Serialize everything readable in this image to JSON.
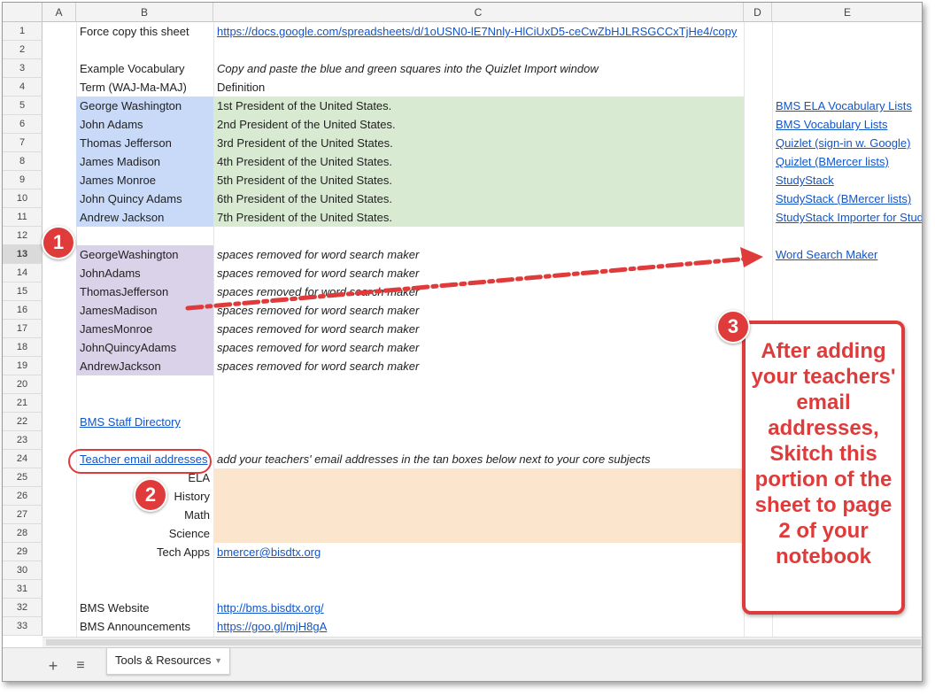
{
  "columns": [
    "A",
    "B",
    "C",
    "D",
    "E"
  ],
  "rows": [
    {
      "n": "1",
      "b": "Force copy this sheet",
      "c": "https://docs.google.com/spreadsheets/d/1oUSN0-lE7Nnly-HlCiUxD5-ceCwZbHJLRSGCCxTjHe4/copy",
      "e": ""
    },
    {
      "n": "2",
      "b": "",
      "c": "",
      "e": ""
    },
    {
      "n": "3",
      "b": "Example Vocabulary",
      "c": "Copy and paste the blue and green squares into the Quizlet Import window",
      "e": ""
    },
    {
      "n": "4",
      "b": "Term (WAJ-Ma-MAJ)",
      "c": "Definition",
      "e": ""
    },
    {
      "n": "5",
      "b": "George Washington",
      "c": "1st President of the United States.",
      "e": "BMS ELA Vocabulary Lists"
    },
    {
      "n": "6",
      "b": "John Adams",
      "c": "2nd President of the United States.",
      "e": "BMS Vocabulary Lists"
    },
    {
      "n": "7",
      "b": "Thomas Jefferson",
      "c": "3rd President of the United States.",
      "e": "Quizlet (sign-in w. Google)"
    },
    {
      "n": "8",
      "b": "James Madison",
      "c": "4th President of the United States.",
      "e": "Quizlet (BMercer lists)"
    },
    {
      "n": "9",
      "b": "James Monroe",
      "c": "5th President of the United States.",
      "e": "StudyStack"
    },
    {
      "n": "10",
      "b": "John Quincy Adams",
      "c": "6th President of the United States.",
      "e": "StudyStack (BMercer lists)"
    },
    {
      "n": "11",
      "b": "Andrew Jackson",
      "c": "7th President of the United States.",
      "e": "StudyStack Importer for Study"
    },
    {
      "n": "12",
      "b": "",
      "c": "",
      "e": ""
    },
    {
      "n": "13",
      "b": "GeorgeWashington",
      "c": "spaces removed for word search maker",
      "e": "Word Search Maker"
    },
    {
      "n": "14",
      "b": "JohnAdams",
      "c": "spaces removed for word search maker",
      "e": ""
    },
    {
      "n": "15",
      "b": "ThomasJefferson",
      "c": "spaces removed for word search maker",
      "e": ""
    },
    {
      "n": "16",
      "b": "JamesMadison",
      "c": "spaces removed for word search maker",
      "e": ""
    },
    {
      "n": "17",
      "b": "JamesMonroe",
      "c": "spaces removed for word search maker",
      "e": ""
    },
    {
      "n": "18",
      "b": "JohnQuincyAdams",
      "c": "spaces removed for word search maker",
      "e": ""
    },
    {
      "n": "19",
      "b": "AndrewJackson",
      "c": "spaces removed for word search maker",
      "e": ""
    },
    {
      "n": "20",
      "b": "",
      "c": "",
      "e": ""
    },
    {
      "n": "21",
      "b": "",
      "c": "",
      "e": ""
    },
    {
      "n": "22",
      "b": "BMS Staff Directory",
      "c": "",
      "e": ""
    },
    {
      "n": "23",
      "b": "",
      "c": "",
      "e": ""
    },
    {
      "n": "24",
      "b": "Teacher email addresses",
      "c": "add your teachers' email addresses in the tan boxes below next to your core subjects",
      "e": ""
    },
    {
      "n": "25",
      "b": "ELA",
      "c": "",
      "e": ""
    },
    {
      "n": "26",
      "b": "History",
      "c": "",
      "e": ""
    },
    {
      "n": "27",
      "b": "Math",
      "c": "",
      "e": ""
    },
    {
      "n": "28",
      "b": "Science",
      "c": "",
      "e": ""
    },
    {
      "n": "29",
      "b": "Tech Apps",
      "c": "bmercer@bisdtx.org",
      "e": ""
    },
    {
      "n": "30",
      "b": "",
      "c": "",
      "e": ""
    },
    {
      "n": "31",
      "b": "",
      "c": "",
      "e": ""
    },
    {
      "n": "32",
      "b": "BMS Website",
      "c": "http://bms.bisdtx.org/",
      "e": ""
    },
    {
      "n": "33",
      "b": "BMS Announcements",
      "c": "https://goo.gl/mjH8gA",
      "e": ""
    }
  ],
  "sheet_tab": {
    "label": "Tools & Resources"
  },
  "annotations": {
    "badge1": "1",
    "badge2": "2",
    "badge3": "3",
    "callout_text": "After adding your teachers' email addresses, Skitch this portion of the sheet to page 2 of your notebook"
  },
  "colors": {
    "annotation_red": "#e03b3b",
    "link": "#1155cc",
    "blue_fill": "#c9daf8",
    "green_fill": "#d9ead3",
    "purple_fill": "#d9d2e9",
    "tan_fill": "#fce5cd"
  }
}
